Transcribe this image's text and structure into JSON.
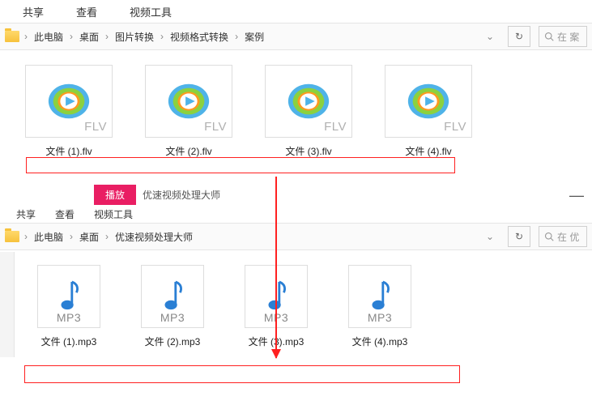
{
  "window1": {
    "tabs": {
      "share": "共享",
      "view": "查看",
      "video_tools": "视频工具"
    },
    "breadcrumb": [
      "此电脑",
      "桌面",
      "图片转换",
      "视频格式转换",
      "案例"
    ],
    "search_placeholder": "在 案",
    "files": [
      {
        "name": "文件 (1).flv",
        "ext": "FLV"
      },
      {
        "name": "文件 (2).flv",
        "ext": "FLV"
      },
      {
        "name": "文件 (3).flv",
        "ext": "FLV"
      },
      {
        "name": "文件 (4).flv",
        "ext": "FLV"
      }
    ]
  },
  "window2": {
    "tabs": {
      "play": "播放",
      "app": "优速视频处理大师",
      "share": "共享",
      "view": "查看",
      "video_tools": "视频工具"
    },
    "breadcrumb": [
      "此电脑",
      "桌面",
      "优速视频处理大师"
    ],
    "search_placeholder": "在 优",
    "files": [
      {
        "name": "文件 (1).mp3",
        "ext": "MP3"
      },
      {
        "name": "文件 (2).mp3",
        "ext": "MP3"
      },
      {
        "name": "文件 (3).mp3",
        "ext": "MP3"
      },
      {
        "name": "文件 (4).mp3",
        "ext": "MP3"
      }
    ]
  },
  "icons": {
    "chevron": "›",
    "refresh": "↻",
    "dropdown": "⌄"
  }
}
